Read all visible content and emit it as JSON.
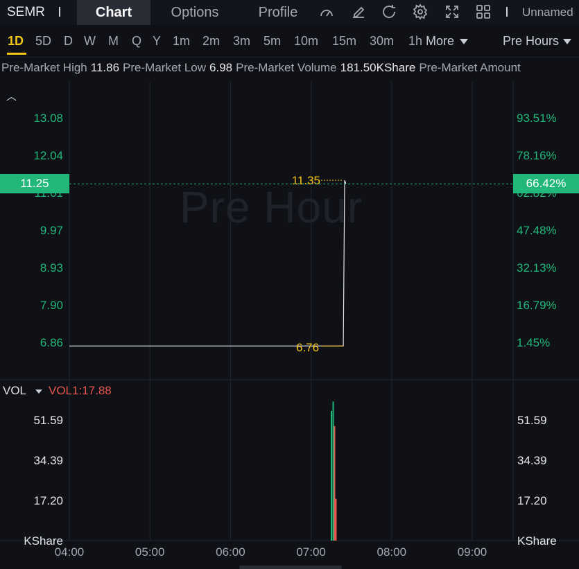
{
  "symbol": "SEMR",
  "tabs": [
    {
      "label": "Chart",
      "active": true
    },
    {
      "label": "Options",
      "active": false
    },
    {
      "label": "Profile",
      "active": false
    }
  ],
  "toolbar_icons": [
    "gauge-icon",
    "edit-icon",
    "refresh-icon",
    "settings-icon",
    "fullscreen-icon",
    "grid-icon"
  ],
  "unnamed_label": "Unnamed",
  "timeframes": [
    "1D",
    "5D",
    "D",
    "W",
    "M",
    "Q",
    "Y",
    "1m",
    "2m",
    "3m",
    "5m",
    "10m",
    "15m",
    "30m",
    "1h"
  ],
  "more_label": "More",
  "session_label": "Pre Hours",
  "info": {
    "high_label": "Pre-Market High",
    "high_value": "11.86",
    "low_label": "Pre-Market Low",
    "low_value": "6.98",
    "volume_label": "Pre-Market Volume",
    "volume_value": "181.50KShare",
    "amount_label": "Pre-Market Amount"
  },
  "watermark": "Pre Hour",
  "price_axis_left": [
    "13.08",
    "12.04",
    "11.01",
    "9.97",
    "8.93",
    "7.90",
    "6.86"
  ],
  "price_axis_right": [
    "93.51%",
    "78.16%",
    "62.82%",
    "47.48%",
    "32.13%",
    "16.79%",
    "1.45%"
  ],
  "current_price": "11.25",
  "current_pct": "66.42%",
  "annot_high": "11.35",
  "annot_low": "6.76",
  "vol": {
    "title": "VOL",
    "value": "VOL1:17.88",
    "axis": [
      "51.59",
      "34.39",
      "17.20"
    ],
    "unit": "KShare"
  },
  "time_axis": [
    "04:00",
    "05:00",
    "06:00",
    "07:00",
    "08:00",
    "09:00"
  ],
  "colors": {
    "up": "#21b879",
    "down": "#e5574f",
    "accent": "#f5c518",
    "price_line": "#e4e6eb"
  },
  "chart_data": {
    "type": "line",
    "x": [
      "04:00",
      "07:24",
      "07:25",
      "07:26"
    ],
    "y": [
      6.76,
      6.76,
      11.35,
      11.25
    ],
    "ylim": [
      6.86,
      13.08
    ],
    "volume_bars": [
      {
        "time": "07:24",
        "value": 55.5,
        "color": "up"
      },
      {
        "time": "07:25",
        "value": 59.5,
        "color": "up"
      },
      {
        "time": "07:25",
        "value": 49.0,
        "color": "down"
      },
      {
        "time": "07:26",
        "value": 17.9,
        "color": "down"
      }
    ],
    "vol_ylim": [
      0,
      68.8
    ]
  }
}
